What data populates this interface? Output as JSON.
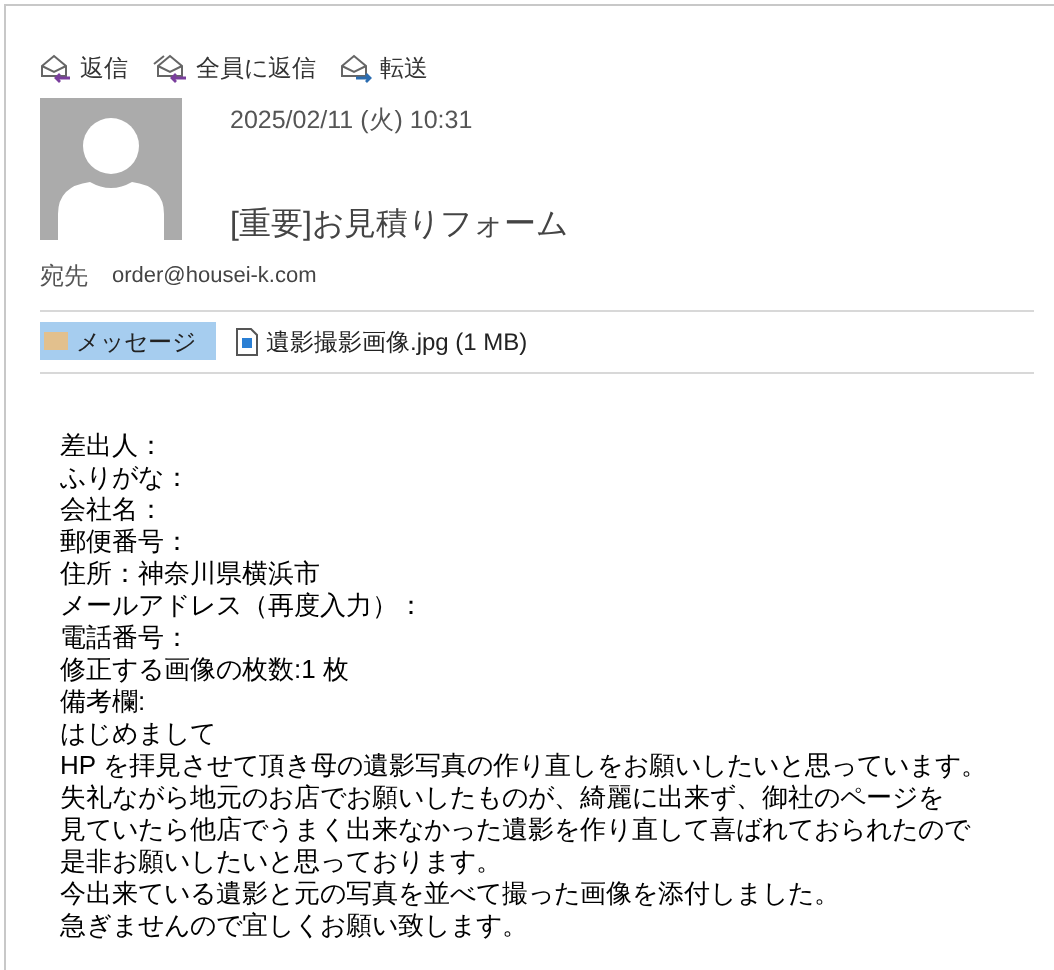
{
  "toolbar": [
    {
      "kind": "reply",
      "label": "返信"
    },
    {
      "kind": "reply_all",
      "label": "全員に返信"
    },
    {
      "kind": "forward",
      "label": "転送"
    }
  ],
  "message": {
    "date": "2025/02/11 (火) 10:31",
    "subject": "[重要]お見積りフォーム",
    "to_label": "宛先",
    "to": "order@housei-k.com"
  },
  "attachments": [
    {
      "kind": "message",
      "label": "メッセージ",
      "selected": true
    },
    {
      "kind": "file",
      "label": "遺影撮影画像.jpg (1 MB)",
      "selected": false
    }
  ],
  "body": [
    "差出人：",
    "ふりがな：",
    "会社名：",
    "郵便番号：",
    "住所：神奈川県横浜市",
    "メールアドレス（再度入力）：",
    "電話番号：",
    "修正する画像の枚数:1 枚",
    "備考欄:",
    "はじめまして",
    "HP を拝見させて頂き母の遺影写真の作り直しをお願いしたいと思っています。",
    "失礼ながら地元のお店でお願いしたものが、綺麗に出来ず、御社のページを",
    "見ていたら他店でうまく出来なかった遺影を作り直して喜ばれておられたので",
    "是非お願いしたいと思っております。",
    "今出来ている遺影と元の写真を並べて撮った画像を添付しました。",
    "急ぎませんので宜しくお願い致します。"
  ]
}
